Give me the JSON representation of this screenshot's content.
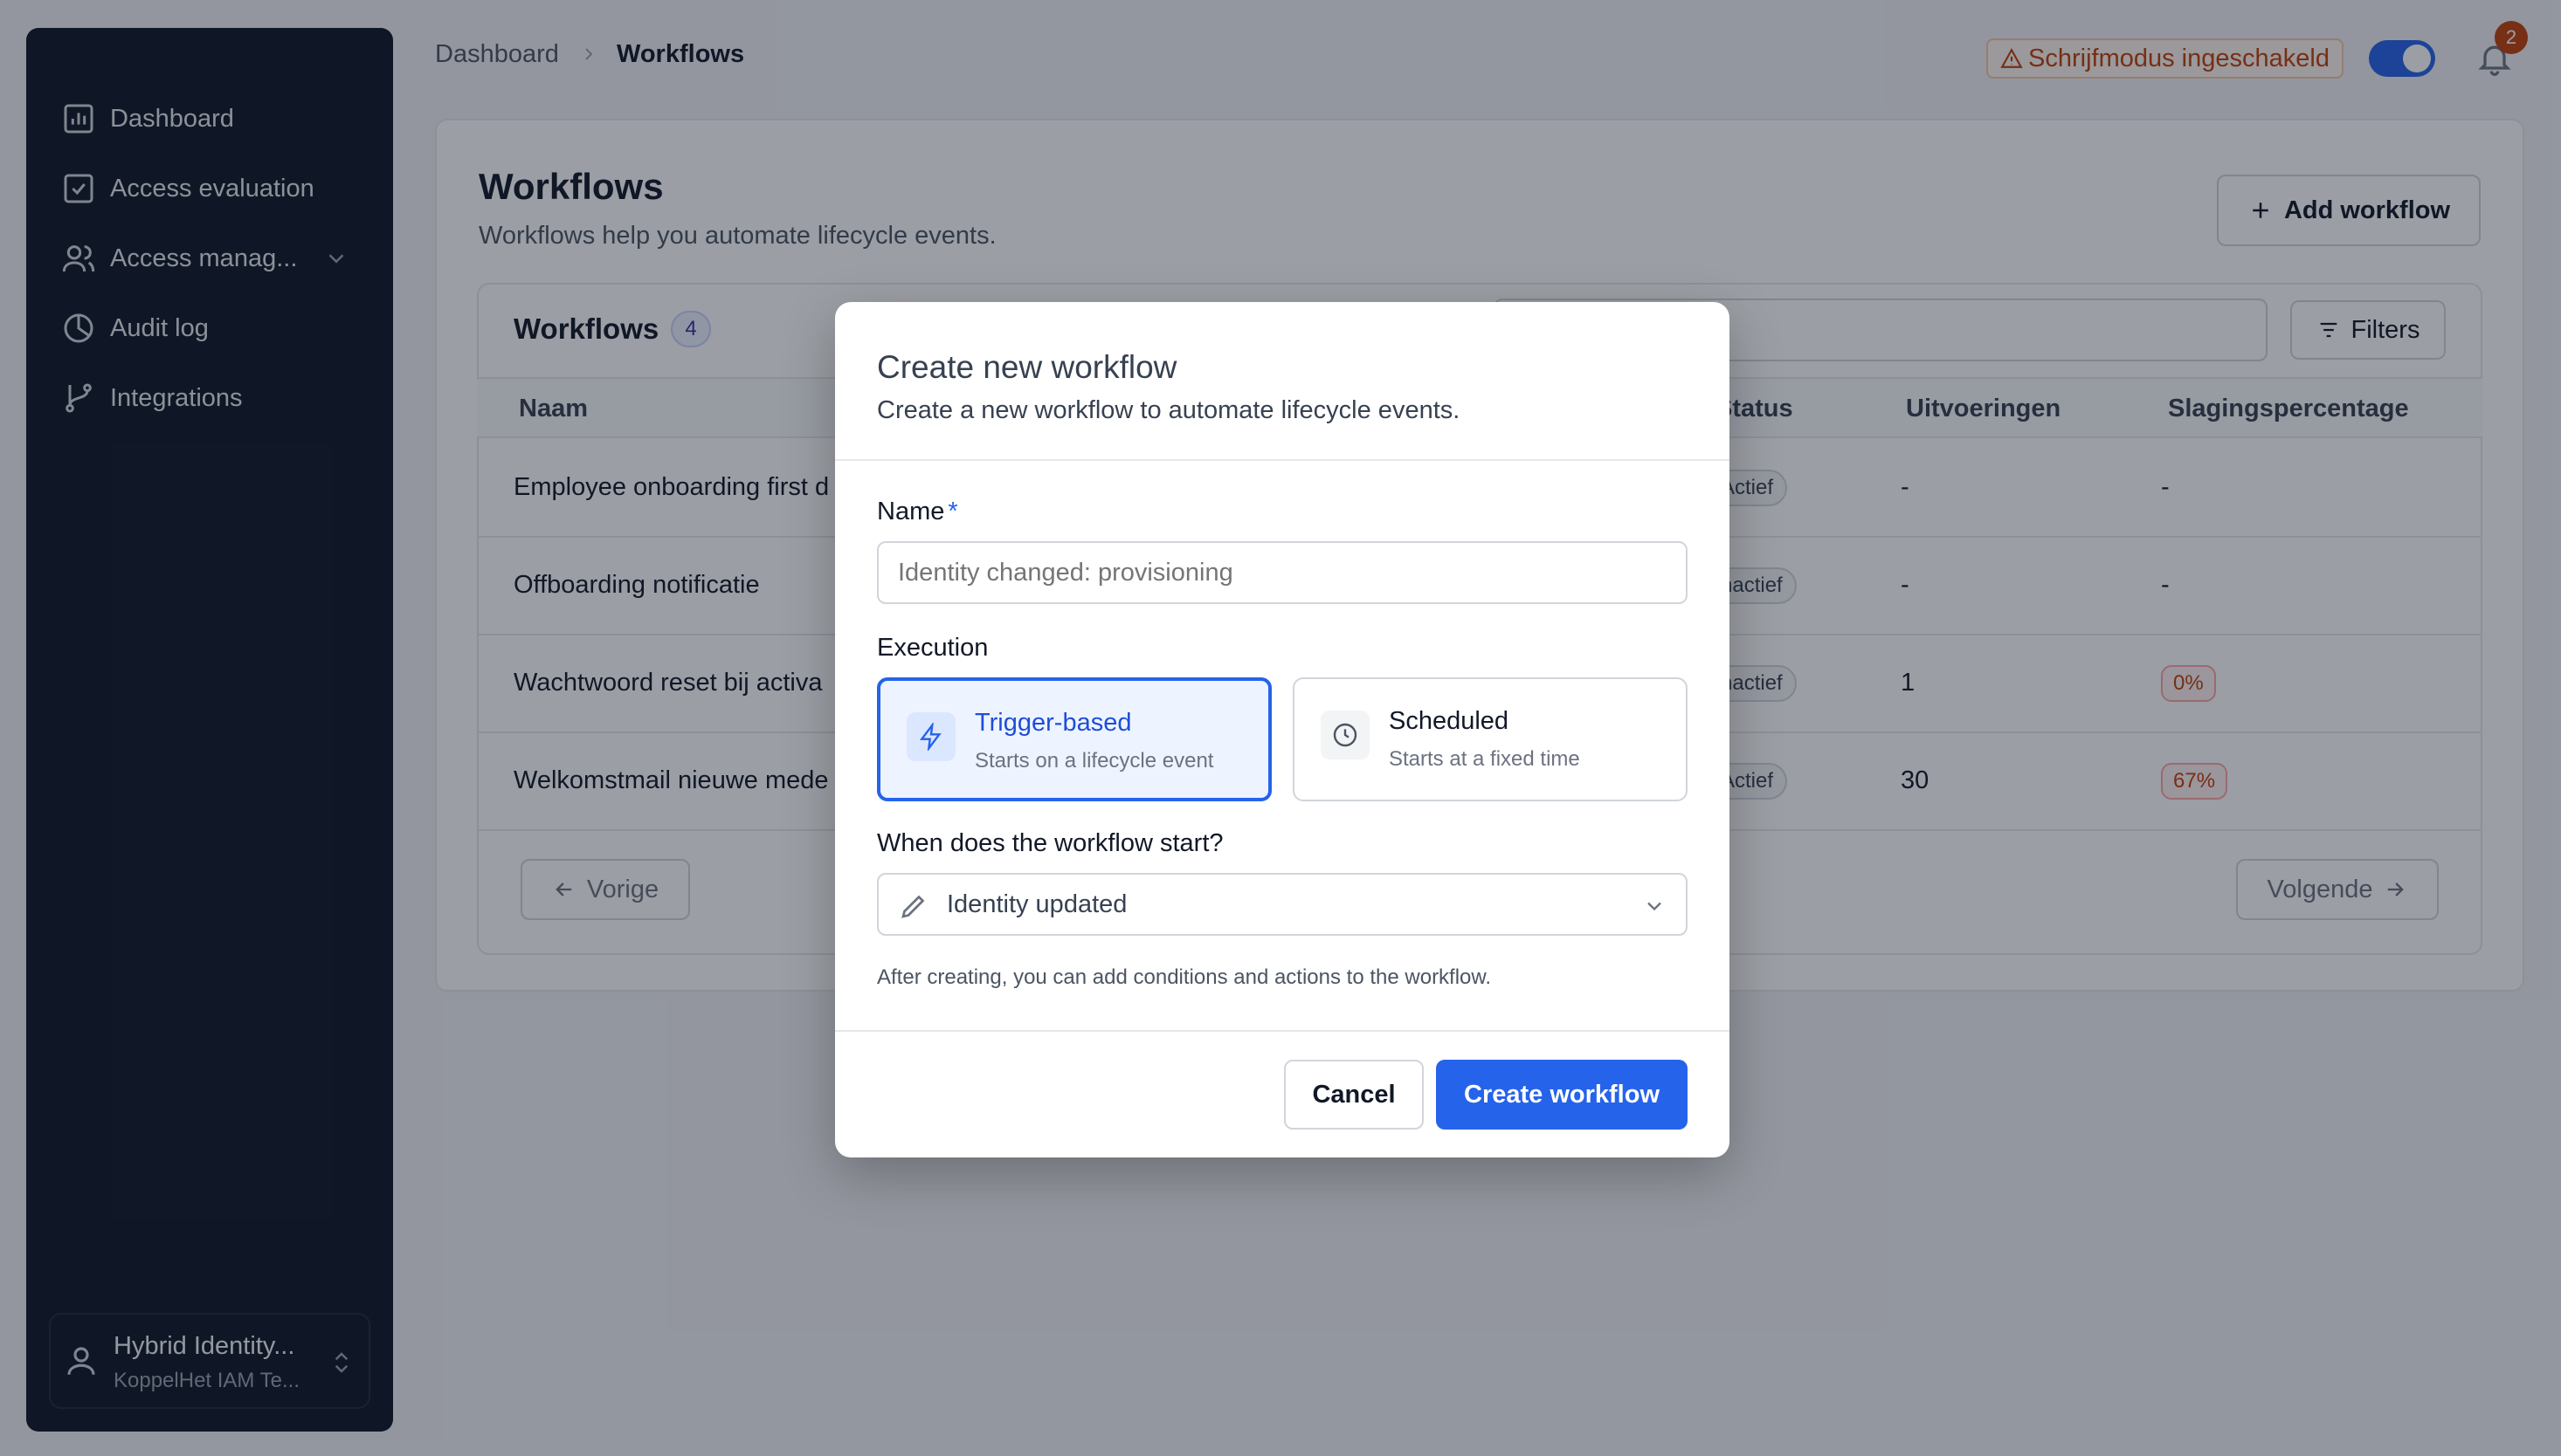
{
  "sidebar": {
    "items": [
      {
        "label": "Dashboard",
        "icon": "bar-chart-icon"
      },
      {
        "label": "Access evaluation",
        "icon": "check-square-icon"
      },
      {
        "label": "Access manag...",
        "icon": "users-icon"
      },
      {
        "label": "Audit log",
        "icon": "pie-chart-icon"
      },
      {
        "label": "Integrations",
        "icon": "git-branch-icon"
      }
    ],
    "user": {
      "name": "Hybrid Identity...",
      "org": "KoppelHet IAM Te..."
    }
  },
  "header": {
    "breadcrumb": [
      "Dashboard",
      "Workflows"
    ],
    "warning_badge": "Schrijfmodus ingeschakeld",
    "notification_count": "2"
  },
  "page": {
    "title": "Workflows",
    "subtitle": "Workflows help you automate lifecycle events.",
    "add_button": "Add workflow"
  },
  "table": {
    "title": "Workflows",
    "count": "4",
    "filters_label": "Filters",
    "columns": [
      "Naam",
      "Status",
      "Uitvoeringen",
      "Slagingspercentage"
    ],
    "rows": [
      {
        "name": "Employee onboarding first d",
        "status": "Actief",
        "runs": "-",
        "rate": "-"
      },
      {
        "name": "Offboarding notificatie",
        "status": "nactief",
        "runs": "-",
        "rate": "-"
      },
      {
        "name": "Wachtwoord reset bij activa",
        "status": "nactief",
        "runs": "1",
        "rate": "0%"
      },
      {
        "name": "Welkomstmail nieuwe mede",
        "status": "Actief",
        "runs": "30",
        "rate": "67%"
      }
    ],
    "prev_label": "Vorige",
    "next_label": "Volgende"
  },
  "modal": {
    "title": "Create new workflow",
    "subtitle": "Create a new workflow to automate lifecycle events.",
    "name_label": "Name",
    "name_required": "*",
    "name_placeholder": "Identity changed: provisioning",
    "execution_label": "Execution",
    "options": [
      {
        "title": "Trigger-based",
        "desc": "Starts on a lifecycle event",
        "icon": "lightning-icon",
        "selected": true
      },
      {
        "title": "Scheduled",
        "desc": "Starts at a fixed time",
        "icon": "clock-icon",
        "selected": false
      }
    ],
    "start_label": "When does the workflow start?",
    "start_value": "Identity updated",
    "hint": "After creating, you can add conditions and actions to the workflow.",
    "cancel_label": "Cancel",
    "create_label": "Create workflow"
  },
  "colors": {
    "primary": "#2563eb",
    "sidebar_bg": "#0f1726",
    "warning": "#c2410c"
  }
}
